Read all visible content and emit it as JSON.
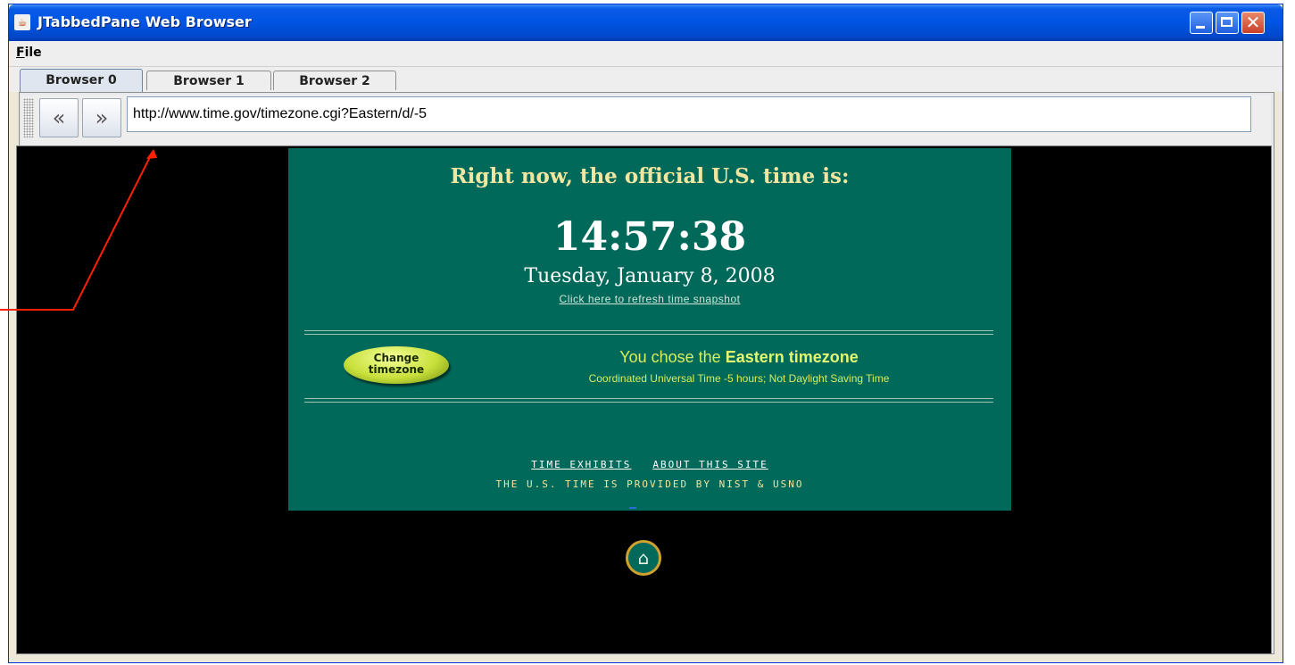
{
  "window": {
    "title": "JTabbedPane Web Browser"
  },
  "menu": {
    "file_mnemonic": "F",
    "file_rest": "ile"
  },
  "tabs": [
    {
      "label": "Browser 0"
    },
    {
      "label": "Browser 1"
    },
    {
      "label": "Browser 2"
    }
  ],
  "toolbar": {
    "back_icon": "«",
    "forward_icon": "»",
    "url": "http://www.time.gov/timezone.cgi?Eastern/d/-5"
  },
  "page": {
    "headline": "Right now, the official U.S. time is:",
    "clock": "14:57:38",
    "date": "Tuesday, January 8, 2008",
    "refresh_link": "Click here to refresh time snapshot",
    "tz_button_line1": "Change",
    "tz_button_line2": "timezone",
    "chose_prefix": "You chose the ",
    "chose_zone": "Eastern timezone",
    "utc_note": "Coordinated Universal Time -5 hours; Not Daylight Saving Time",
    "link_exhibits": "TIME EXHIBITS",
    "link_about": "ABOUT THIS SITE",
    "provided_by": "THE U.S. TIME IS PROVIDED BY NIST & USNO",
    "home_icon": "⌂"
  },
  "colors": {
    "title_bar": "#0054e3",
    "page_green": "#00695a",
    "headline_gold": "#f0e6a0",
    "zone_text": "#d8ee5c",
    "annotation_arrow": "#ff2000"
  }
}
